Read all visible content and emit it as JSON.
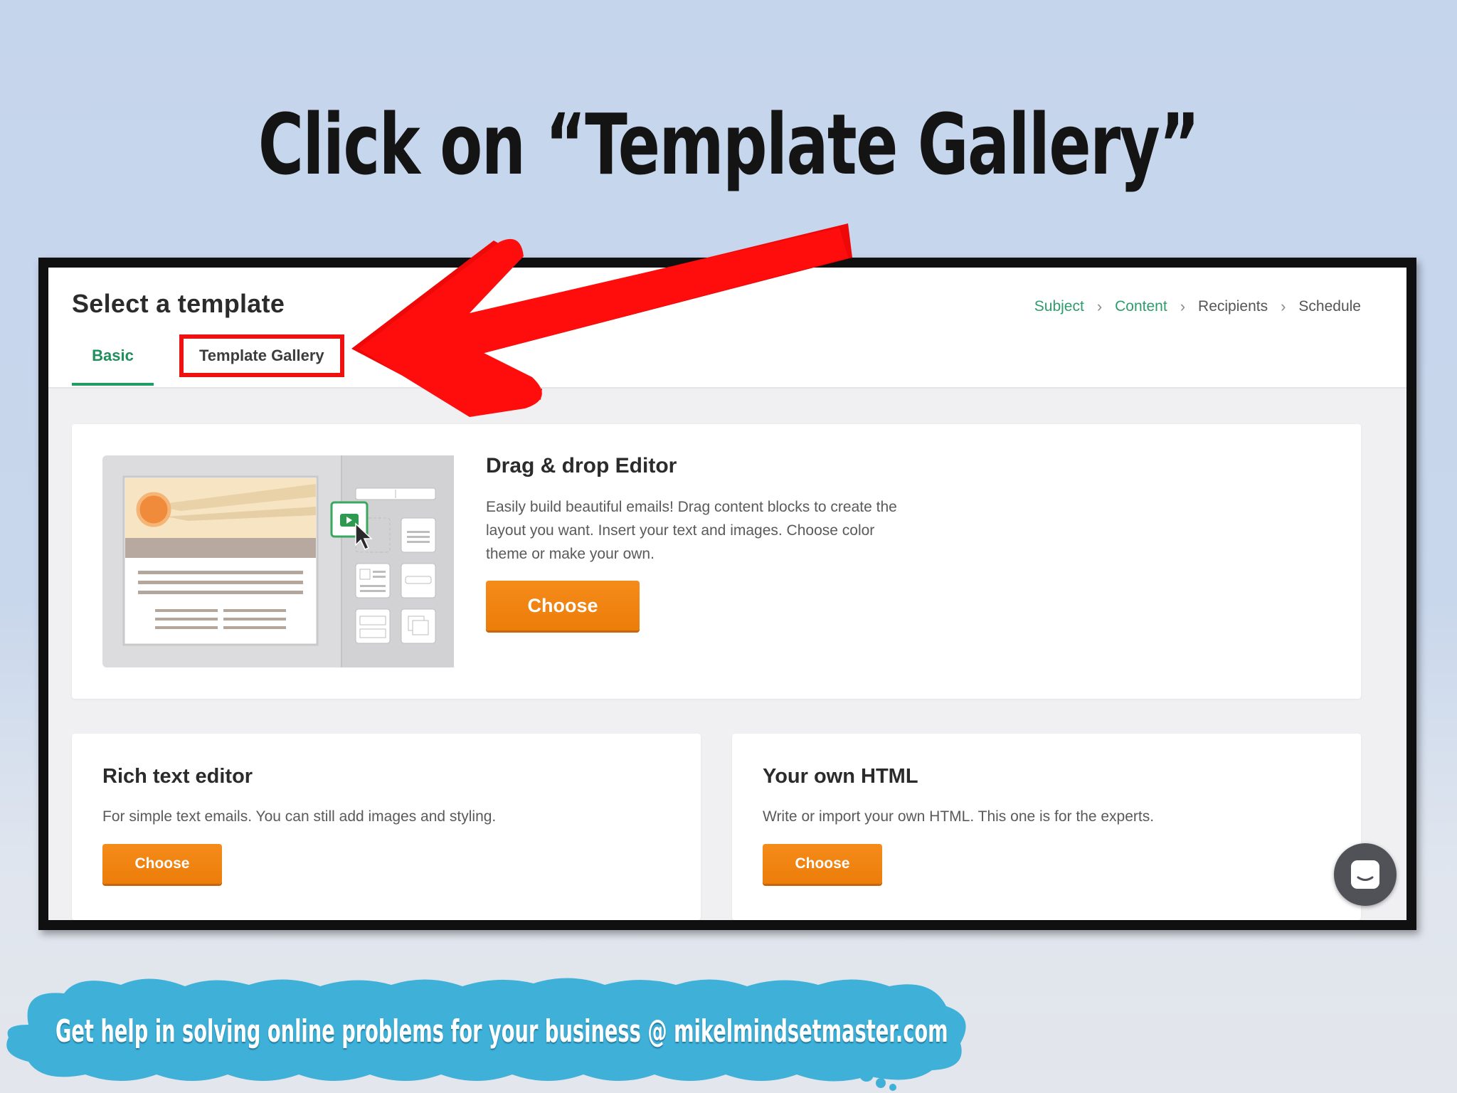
{
  "slide": {
    "title": "Click on “Template Gallery”",
    "footer": "Get help in solving online problems for your business @ mikelmindsetmaster.com"
  },
  "app": {
    "page_title": "Select a template",
    "steps": [
      {
        "label": "Subject",
        "active": true
      },
      {
        "label": "Content",
        "active": true
      },
      {
        "label": "Recipients",
        "active": false
      },
      {
        "label": "Schedule",
        "active": false
      }
    ],
    "tabs": {
      "basic": "Basic",
      "gallery": "Template Gallery",
      "selected": "Basic"
    },
    "cards": {
      "drag_drop": {
        "title": "Drag & drop Editor",
        "description": "Easily build beautiful emails! Drag content blocks to create the layout you want. Insert your text and images. Choose color theme or make your own.",
        "button": "Choose"
      },
      "rich_text": {
        "title": "Rich text editor",
        "description": "For simple text emails. You can still add images and styling.",
        "button": "Choose"
      },
      "own_html": {
        "title": "Your own HTML",
        "description": "Write or import your own HTML. This one is for the experts.",
        "button": "Choose"
      }
    },
    "icons": {
      "chat": "chat-icon",
      "arrow": "red-arrow-annotation",
      "video_block": "video-block-icon",
      "cursor": "mouse-cursor-icon"
    },
    "colors": {
      "accent_green": "#1f9d62",
      "button_orange": "#ef800d",
      "highlight_red": "#ee1111"
    }
  }
}
